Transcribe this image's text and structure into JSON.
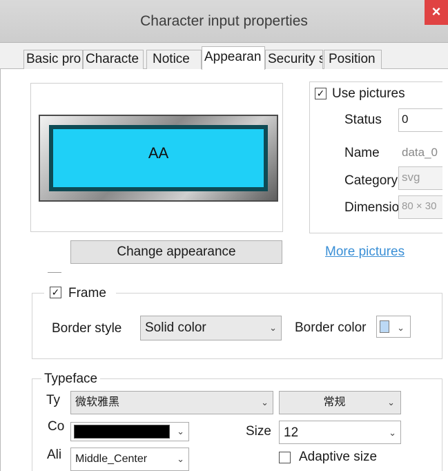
{
  "window": {
    "title": "Character input properties",
    "close_glyph": "×"
  },
  "tabs": [
    {
      "label": "Basic pro",
      "active": false
    },
    {
      "label": "Characte",
      "active": false
    },
    {
      "label": "Notice",
      "active": false
    },
    {
      "label": "Appearan",
      "active": true
    },
    {
      "label": "Security s",
      "active": false
    },
    {
      "label": "Position",
      "active": false
    }
  ],
  "preview": {
    "text": "AA",
    "fill_color": "#1fd0f7"
  },
  "pictures": {
    "use_pictures_label": "Use pictures",
    "use_pictures_checked": true,
    "status_label": "Status",
    "status_value": "0",
    "name_label": "Name",
    "name_value": "data_0",
    "category_label": "Category",
    "category_value": "svg",
    "dimension_label": "Dimension",
    "dimension_value": "80 × 30"
  },
  "actions": {
    "change_appearance": "Change appearance",
    "more_pictures": "More pictures"
  },
  "frame": {
    "label": "Frame",
    "checked": true,
    "border_style_label": "Border style",
    "border_style_value": "Solid color",
    "border_color_label": "Border color",
    "border_color": "#bcd9f5"
  },
  "typeface": {
    "group_label": "Typeface",
    "type_label": "Ty",
    "type_value": "微软雅黑",
    "style_value": "常规",
    "color_label": "Co",
    "color_value": "#000000",
    "size_label": "Size",
    "size_value": "12",
    "align_label": "Ali",
    "align_value": "Middle_Center",
    "adaptive_label": "Adaptive size",
    "adaptive_checked": false
  },
  "icons": {
    "check": "✓",
    "dropdown": "⌄"
  }
}
